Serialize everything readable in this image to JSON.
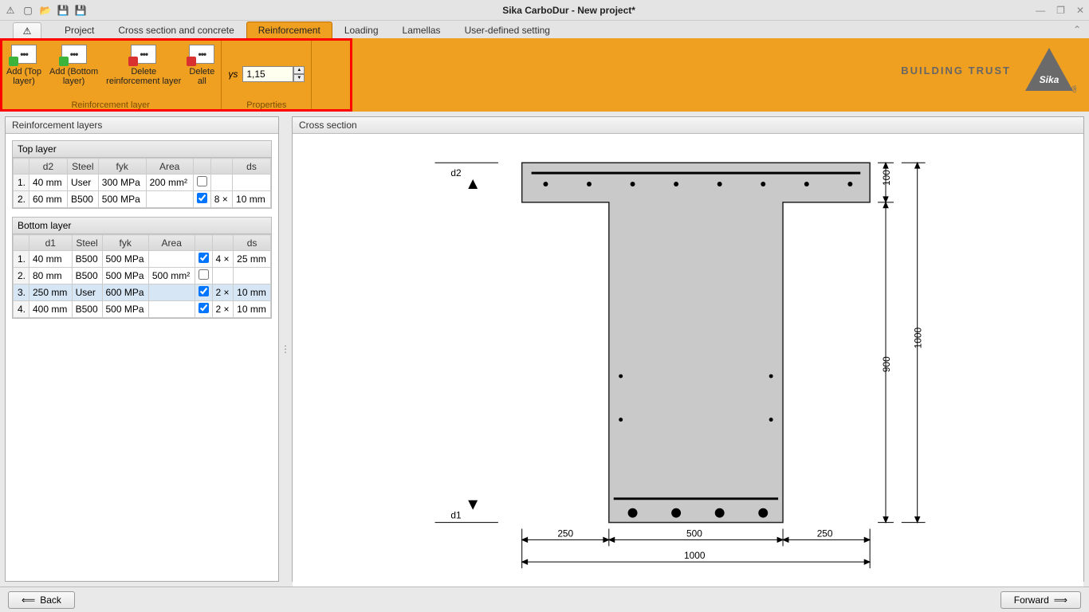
{
  "title": "Sika CarboDur - New project*",
  "brand": {
    "tag": "BUILDING TRUST"
  },
  "qa_icons": [
    "warning",
    "new",
    "open",
    "save",
    "saveas"
  ],
  "tabs": [
    "Project",
    "Cross section and concrete",
    "Reinforcement",
    "Loading",
    "Lamellas",
    "User-defined setting"
  ],
  "active_tab": "Reinforcement",
  "ribbon": {
    "group1_caption": "Reinforcement layer",
    "group2_caption": "Properties",
    "add_top": "Add (Top\nlayer)",
    "add_bottom": "Add (Bottom\nlayer)",
    "del_layer": "Delete\nreinforcement layer",
    "del_all": "Delete\nall",
    "gamma_s_label": "γs",
    "gamma_s_value": "1,15"
  },
  "left_panel_title": "Reinforcement layers",
  "right_panel_title": "Cross section",
  "top_group_title": "Top layer",
  "bottom_group_title": "Bottom layer",
  "columns": {
    "d2": "d2",
    "d1": "d1",
    "steel": "Steel",
    "fyk": "fyk",
    "area": "Area",
    "n": "",
    "ds": "ds"
  },
  "top_rows": [
    {
      "n": "1.",
      "d": "40 mm",
      "steel": "User",
      "fyk": "300 MPa",
      "area": "200 mm²",
      "chk": false,
      "count": "",
      "ds": ""
    },
    {
      "n": "2.",
      "d": "60 mm",
      "steel": "B500",
      "fyk": "500 MPa",
      "area": "",
      "chk": true,
      "count": "8 ×",
      "ds": "10 mm"
    }
  ],
  "bottom_rows": [
    {
      "n": "1.",
      "d": "40 mm",
      "steel": "B500",
      "fyk": "500 MPa",
      "area": "",
      "chk": true,
      "count": "4 ×",
      "ds": "25 mm",
      "sel": false
    },
    {
      "n": "2.",
      "d": "80 mm",
      "steel": "B500",
      "fyk": "500 MPa",
      "area": "500 mm²",
      "chk": false,
      "count": "",
      "ds": "",
      "sel": false
    },
    {
      "n": "3.",
      "d": "250 mm",
      "steel": "User",
      "fyk": "600 MPa",
      "area": "",
      "chk": true,
      "count": "2 ×",
      "ds": "10 mm",
      "sel": true
    },
    {
      "n": "4.",
      "d": "400 mm",
      "steel": "B500",
      "fyk": "500 MPa",
      "area": "",
      "chk": true,
      "count": "2 ×",
      "ds": "10 mm",
      "sel": false
    }
  ],
  "dims": {
    "d2": "d2",
    "d1": "d1",
    "h100": "100",
    "h900": "900",
    "h1000": "1000",
    "w250l": "250",
    "w500": "500",
    "w250r": "250",
    "w1000": "1000"
  },
  "footer": {
    "back": "Back",
    "forward": "Forward"
  }
}
